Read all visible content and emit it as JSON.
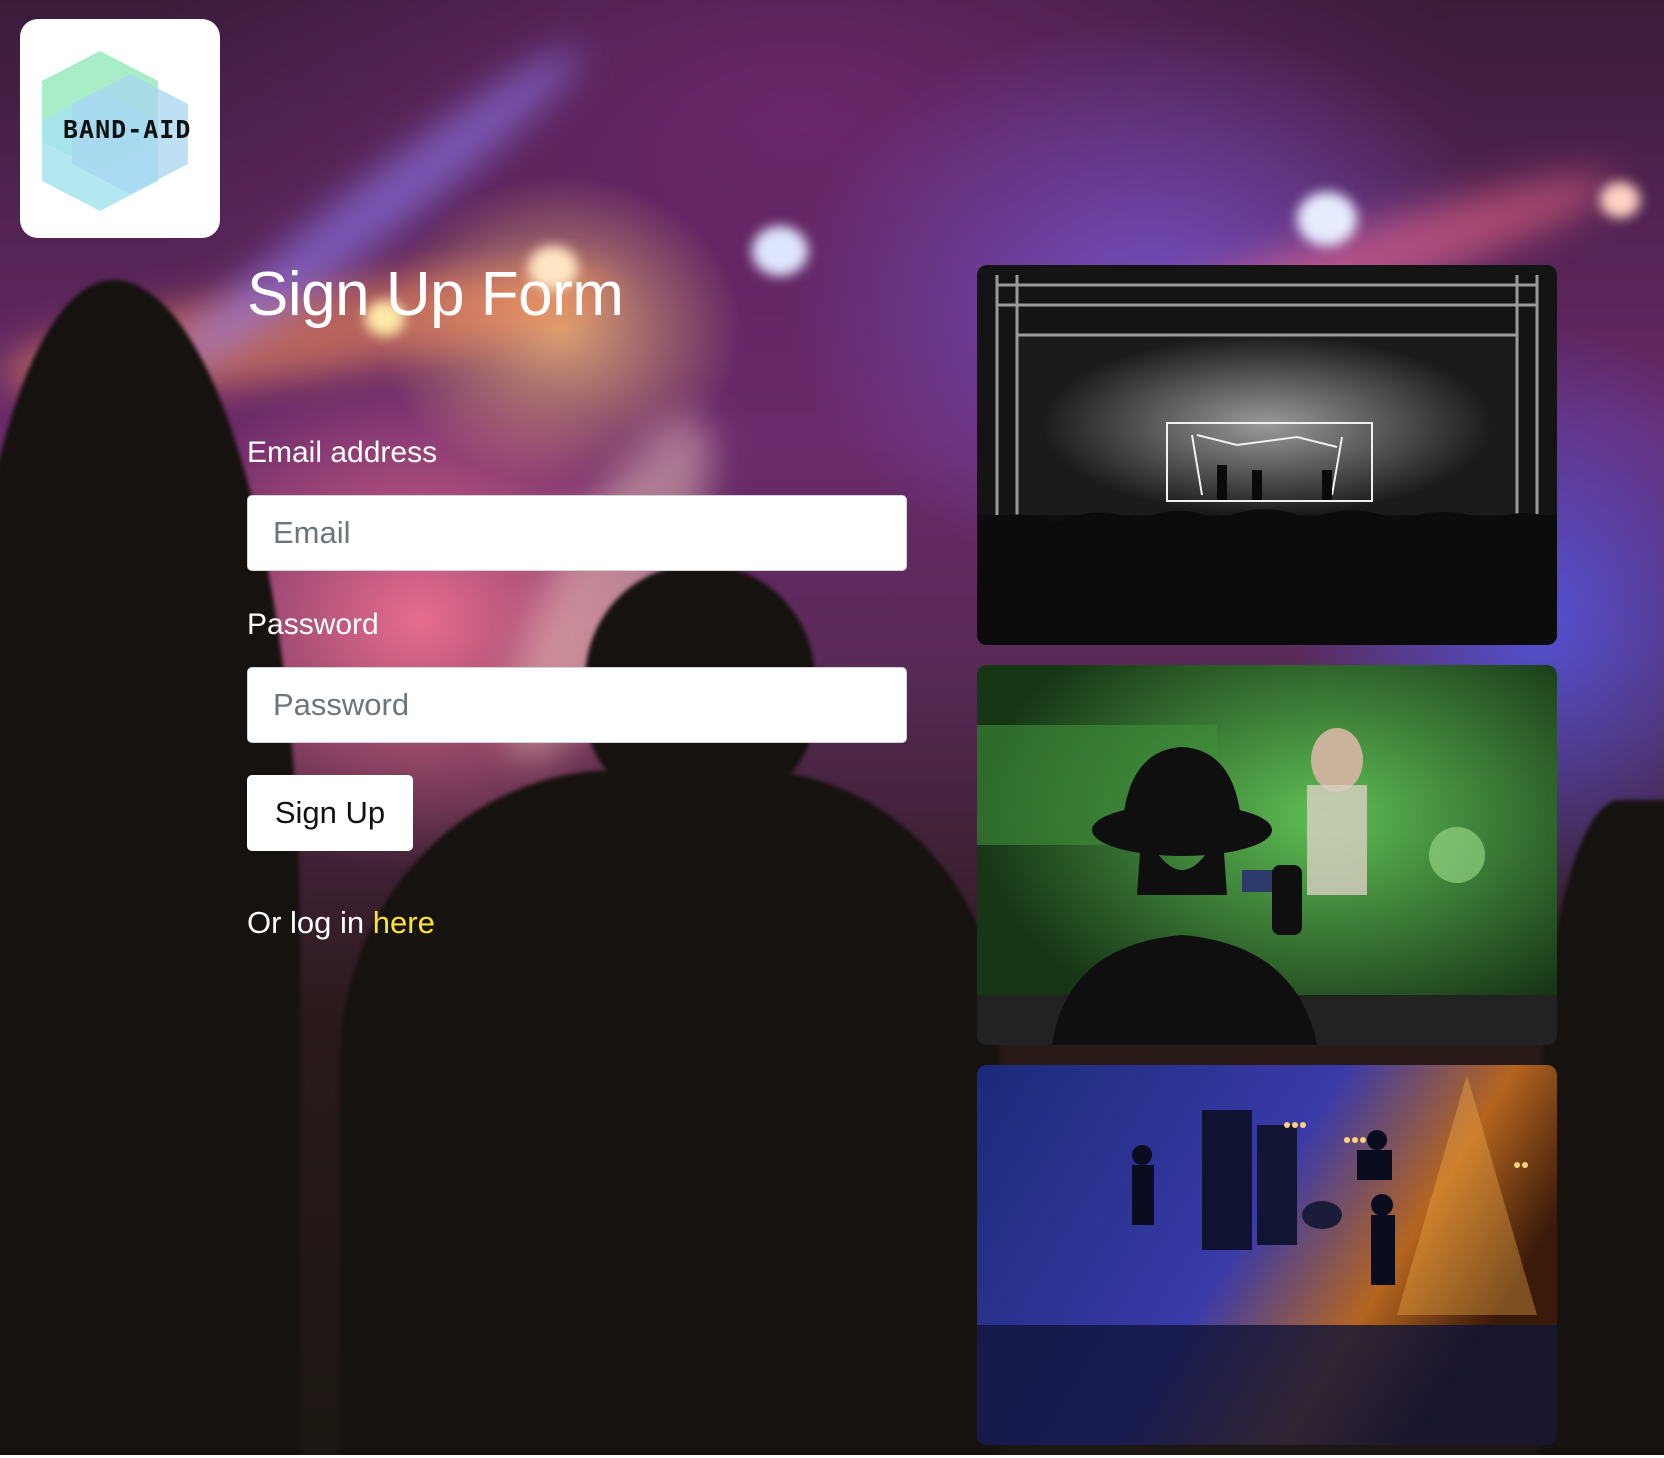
{
  "logo": {
    "text": "BAND-AID",
    "icon": "hexagon-logo-icon"
  },
  "form": {
    "title": "Sign Up Form",
    "email_label": "Email address",
    "email_placeholder": "Email",
    "email_value": "",
    "password_label": "Password",
    "password_placeholder": "Password",
    "password_value": "",
    "submit_label": "Sign Up",
    "login_prefix": "Or log in",
    "login_link": "here"
  },
  "colors": {
    "link": "#ffe52a",
    "input_border": "#ced4da",
    "logo_hex_green": "#a8ecc8",
    "logo_hex_blue": "#a6e4ef"
  }
}
